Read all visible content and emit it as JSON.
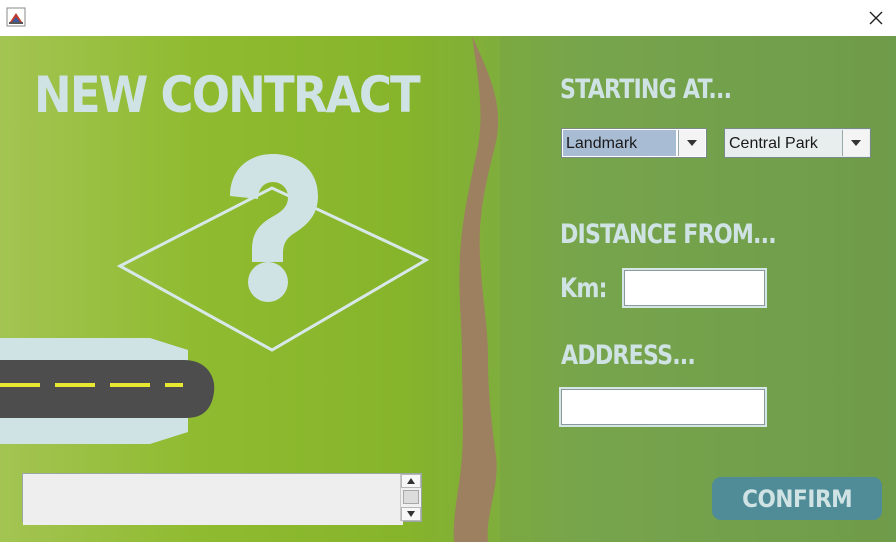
{
  "window": {
    "app_icon": "java-cup-icon",
    "close_icon": "close-icon"
  },
  "form": {
    "title": "NEW CONTRACT",
    "starting_heading": "STARTING AT...",
    "start_type_select": {
      "selected": "Landmark"
    },
    "start_place_select": {
      "selected": "Central Park"
    },
    "distance_heading": "DISTANCE FROM...",
    "km_label": "Km:",
    "km_value": "",
    "address_heading": "ADDRESS...",
    "address_value": "",
    "confirm_label": "CONFIRM",
    "notes_value": ""
  },
  "illustration": {
    "icon": "question-mark-icon",
    "road": "road-icon",
    "path": "dirt-path-icon"
  },
  "colors": {
    "accent": "#4f8c98",
    "text_light": "#cfe3e4",
    "grass": "#86b42a",
    "path": "#9c8060",
    "road": "#4d4d4d",
    "road_marking": "#e8e830"
  }
}
